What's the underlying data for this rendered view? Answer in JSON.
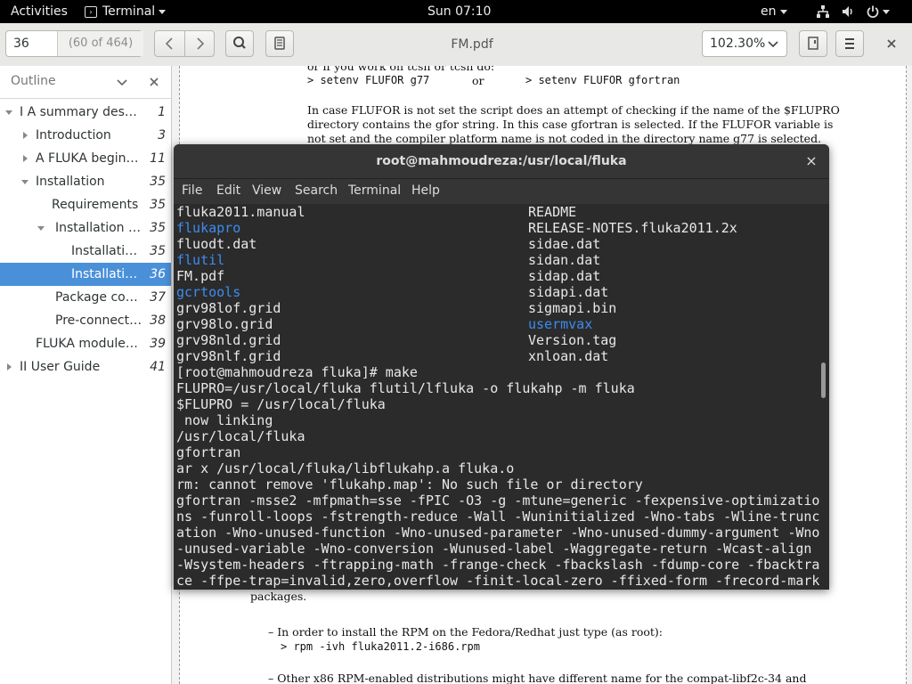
{
  "topbar": {
    "activities": "Activities",
    "app_name": "Terminal",
    "clock": "Sun 07:10",
    "lang": "en"
  },
  "toolbar": {
    "page_number": "36",
    "page_of": "(60 of 464)",
    "doc_title": "FM.pdf",
    "zoom": "102.30%"
  },
  "sidebar": {
    "header": "Outline",
    "items": [
      {
        "label": "I A summary descrip...",
        "page": "1"
      },
      {
        "label": "Introduction",
        "page": "3"
      },
      {
        "label": "A FLUKA beginne...",
        "page": "11"
      },
      {
        "label": "Installation",
        "page": "35"
      },
      {
        "label": "Requirements",
        "page": "35"
      },
      {
        "label": "Installation in...",
        "page": "35"
      },
      {
        "label": "Installation...",
        "page": "35"
      },
      {
        "label": "Installation...",
        "page": "36"
      },
      {
        "label": "Package cont...",
        "page": "37"
      },
      {
        "label": "Pre-connecte...",
        "page": "38"
      },
      {
        "label": "FLUKA modules (...",
        "page": "39"
      },
      {
        "label": "II User Guide",
        "page": "41"
      }
    ]
  },
  "document": {
    "line0": "or if you work on tcsh or tcsh do:",
    "line1a": "> setenv FLUFOR g77",
    "line1b": "or",
    "line1c": "> setenv FLUFOR gfortran",
    "para1": [
      "In case FLUFOR is not set the script does an attempt of checking if the name of the $FLUPRO",
      "directory contains the gfor string.  In this case gfortran is selected.  If the FLUFOR variable is",
      "not set and the compiler platform name is not coded in the directory name g77 is selected."
    ],
    "packages": "packages.",
    "rpm_intro": "– In order to install the RPM on the Fedora/Redhat just type (as root):",
    "rpm_cmd": "> rpm -ivh fluka2011.2-i686.rpm",
    "other": "– Other x86 RPM-enabled distributions might have different name for the compat-libf2c-34 and"
  },
  "terminal": {
    "title": "root@mahmoudreza:/usr/local/fluka",
    "menu": [
      "File",
      "Edit",
      "View",
      "Search",
      "Terminal",
      "Help"
    ],
    "listing_left": [
      {
        "text": "fluka2011.manual",
        "dir": false
      },
      {
        "text": "flukapro",
        "dir": true
      },
      {
        "text": "fluodt.dat",
        "dir": false
      },
      {
        "text": "flutil",
        "dir": true
      },
      {
        "text": "FM.pdf",
        "dir": false
      },
      {
        "text": "gcrtools",
        "dir": true
      },
      {
        "text": "grv98lof.grid",
        "dir": false
      },
      {
        "text": "grv98lo.grid",
        "dir": false
      },
      {
        "text": "grv98nld.grid",
        "dir": false
      },
      {
        "text": "grv98nlf.grid",
        "dir": false
      }
    ],
    "listing_right": [
      {
        "text": "README",
        "dir": false
      },
      {
        "text": "RELEASE-NOTES.fluka2011.2x",
        "dir": false
      },
      {
        "text": "sidae.dat",
        "dir": false
      },
      {
        "text": "sidan.dat",
        "dir": false
      },
      {
        "text": "sidap.dat",
        "dir": false
      },
      {
        "text": "sidapi.dat",
        "dir": false
      },
      {
        "text": "sigmapi.bin",
        "dir": false
      },
      {
        "text": "usermvax",
        "dir": true
      },
      {
        "text": "Version.tag",
        "dir": false
      },
      {
        "text": "xnloan.dat",
        "dir": false
      }
    ],
    "output": [
      "[root@mahmoudreza fluka]# make",
      "FLUPRO=/usr/local/fluka flutil/lfluka -o flukahp -m fluka",
      "$FLUPRO = /usr/local/fluka",
      " now linking",
      "/usr/local/fluka",
      "gfortran",
      "ar x /usr/local/fluka/libflukahp.a fluka.o",
      "rm: cannot remove 'flukahp.map': No such file or directory",
      "gfortran -msse2 -mfpmath=sse -fPIC -O3 -g -mtune=generic -fexpensive-optimizatio",
      "ns -funroll-loops -fstrength-reduce -Wall -Wuninitialized -Wno-tabs -Wline-trunc",
      "ation -Wno-unused-function -Wno-unused-parameter -Wno-unused-dummy-argument -Wno",
      "-unused-variable -Wno-conversion -Wunused-label -Waggregate-return -Wcast-align",
      "-Wsystem-headers -ftrapping-math -frange-check -fbackslash -fdump-core -fbacktra",
      "ce -ffpe-trap=invalid,zero,overflow -finit-local-zero -ffixed-form -frecord-mark"
    ]
  },
  "colors": {
    "selection": "#4a90d9",
    "terminal_bg": "#2b2b2b",
    "directory": "#3c8cf0"
  }
}
